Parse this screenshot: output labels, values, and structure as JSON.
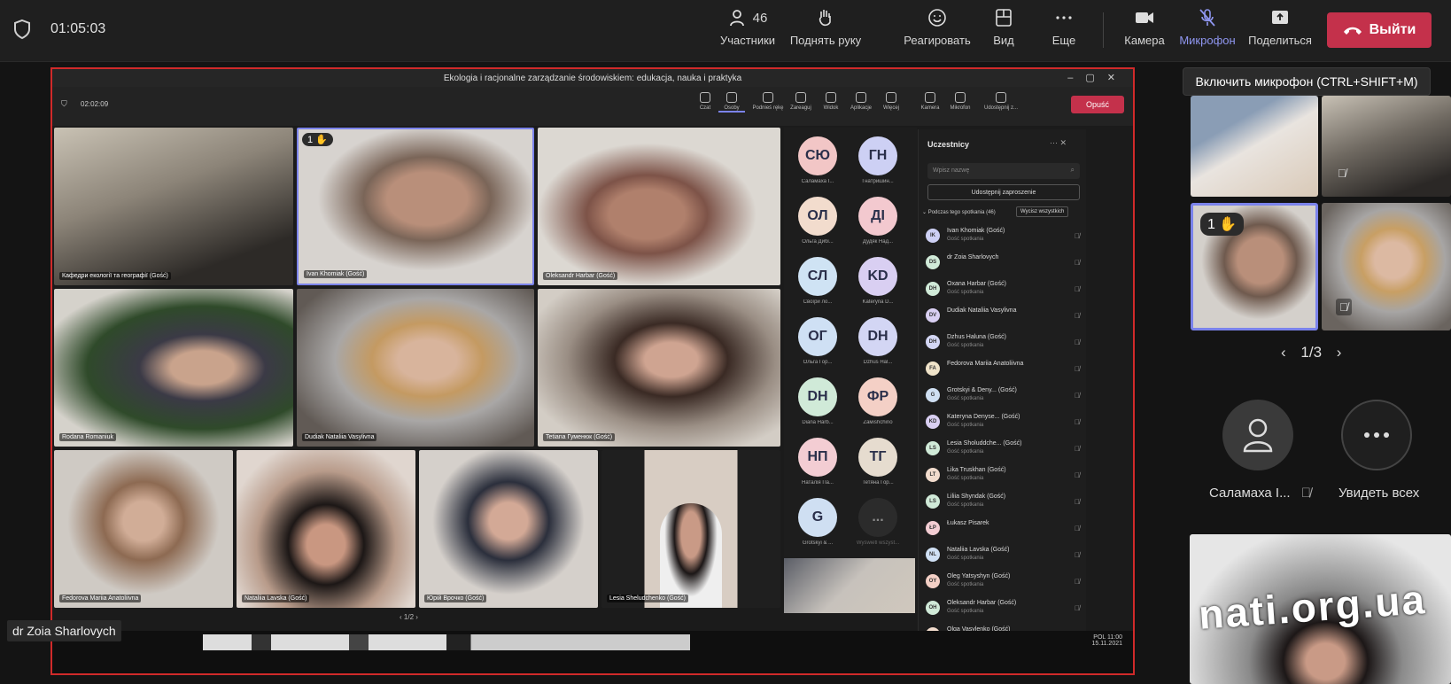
{
  "topbar": {
    "timer": "01:05:03",
    "participants_count": "46",
    "participants_label": "Участники",
    "raise_hand_label": "Поднять руку",
    "react_label": "Реагировать",
    "view_label": "Вид",
    "more_label": "Еще",
    "camera_label": "Камера",
    "mic_label": "Микрофон",
    "share_label": "Поделиться",
    "leave_label": "Выйти"
  },
  "tooltip": "Включить микрофон (CTRL+SHIFT+M)",
  "shared": {
    "window_title": "Ekologia i racjonalne zarządzanie środowiskiem: edukacja, nauka i praktyka",
    "inner_timer": "02:02:09",
    "inner_buttons": [
      "Czat",
      "Osoby",
      "Podnieś rękę",
      "Zareaguj",
      "Widok",
      "Aplikacje",
      "Więcej",
      "Kamera",
      "Mikrofon",
      "Udostępnij z..."
    ],
    "inner_leave": "Opuść",
    "tiles": [
      {
        "name": "Кафедри екології та географії (Gość)"
      },
      {
        "name": "Ivan Khomiak (Gość)",
        "hand": "1"
      },
      {
        "name": "Oleksandr Harbar (Gość)"
      },
      {
        "name": "Rodana Romaniuk"
      },
      {
        "name": "Dudiak Nataliia Vasylivna"
      },
      {
        "name": "Tetiana Гуменюк (Gość)"
      },
      {
        "name": "Fedorova Mariia Anatoliivna"
      },
      {
        "name": "Nataliia Lavska (Gość)"
      },
      {
        "name": "Юрій Врочко (Gość)"
      },
      {
        "name": "Lesia Sheludchenko (Gość)"
      }
    ],
    "pager": "1/2",
    "avatars": [
      {
        "i": "СЮ",
        "l": "Саламаха І..."
      },
      {
        "i": "ГН",
        "l": "Гнатришин..."
      },
      {
        "i": "ОЛ",
        "l": "Ольга Дибі..."
      },
      {
        "i": "ДІ",
        "l": "Дудяк Над..."
      },
      {
        "i": "СЛ",
        "l": "Своїри ло..."
      },
      {
        "i": "KD",
        "l": "Kateryna D..."
      },
      {
        "i": "ОГ",
        "l": "Ольга Гор..."
      },
      {
        "i": "DH",
        "l": "Dzhus Hal..."
      },
      {
        "i": "DH",
        "l": "Diana Harb..."
      },
      {
        "i": "ФР",
        "l": "Zaмishchino"
      },
      {
        "i": "НП",
        "l": "Наталія Па..."
      },
      {
        "i": "ТГ",
        "l": "Тетяна Гор..."
      },
      {
        "i": "G",
        "l": "Grotskyi & ..."
      },
      {
        "i": "...",
        "l": "Wyświetl wszyst..."
      }
    ],
    "people_panel": {
      "title": "Uczestnicy",
      "search_placeholder": "Wpisz nazwę",
      "share_invite": "Udostępnij zaproszenie",
      "section": "Podczas tego spotkania (46)",
      "mute_all": "Wycisz wszystkich",
      "people": [
        {
          "i": "IK",
          "n": "Ivan Khomiak (Gość)",
          "s": "Gość spotkania"
        },
        {
          "i": "DS",
          "n": "dr Zoia Sharlovych",
          "s": ""
        },
        {
          "i": "DH",
          "n": "Oxana Harbar (Gość)",
          "s": "Gość spotkania"
        },
        {
          "i": "DV",
          "n": "Dudiak Nataliia Vasylivna",
          "s": ""
        },
        {
          "i": "DH",
          "n": "Dzhus Haluna (Gość)",
          "s": "Gość spotkania"
        },
        {
          "i": "FA",
          "n": "Fedorova Mariia Anatoliivna",
          "s": ""
        },
        {
          "i": "G",
          "n": "Grotskyi & Deny... (Gość)",
          "s": "Gość spotkania"
        },
        {
          "i": "KD",
          "n": "Kateryna Denyse... (Gość)",
          "s": "Gość spotkania"
        },
        {
          "i": "LS",
          "n": "Lesia Sholuddche... (Gość)",
          "s": "Gość spotkania"
        },
        {
          "i": "LT",
          "n": "Lika Truskhan (Gość)",
          "s": "Gość spotkania"
        },
        {
          "i": "LS",
          "n": "Liliia Shyndak (Gość)",
          "s": "Gość spotkania"
        },
        {
          "i": "ŁP",
          "n": "Łukasz Pisarek",
          "s": ""
        },
        {
          "i": "NL",
          "n": "Nataliia Lavska (Gość)",
          "s": "Gość spotkania"
        },
        {
          "i": "OY",
          "n": "Oleg Yatsyshyn (Gość)",
          "s": "Gość spotkania"
        },
        {
          "i": "OH",
          "n": "Oleksandr Harbar (Gość)",
          "s": "Gość spotkania"
        },
        {
          "i": "OV",
          "n": "Olga Vasylenko (Gość)",
          "s": ""
        }
      ]
    },
    "taskbar_clock": "11:00",
    "taskbar_date": "15.11.2021",
    "taskbar_lang": "POL"
  },
  "presenter_label": "dr Zoia Sharlovych",
  "right": {
    "hand": "1",
    "pager": "1/3",
    "salamaha_label": "Саламаха І...",
    "see_all_label": "Увидеть всех",
    "watermark": "nati.org.ua"
  },
  "colors": {
    "leave": "#c4314b",
    "accent": "#7b83eb",
    "share_border": "#d02a2a"
  }
}
